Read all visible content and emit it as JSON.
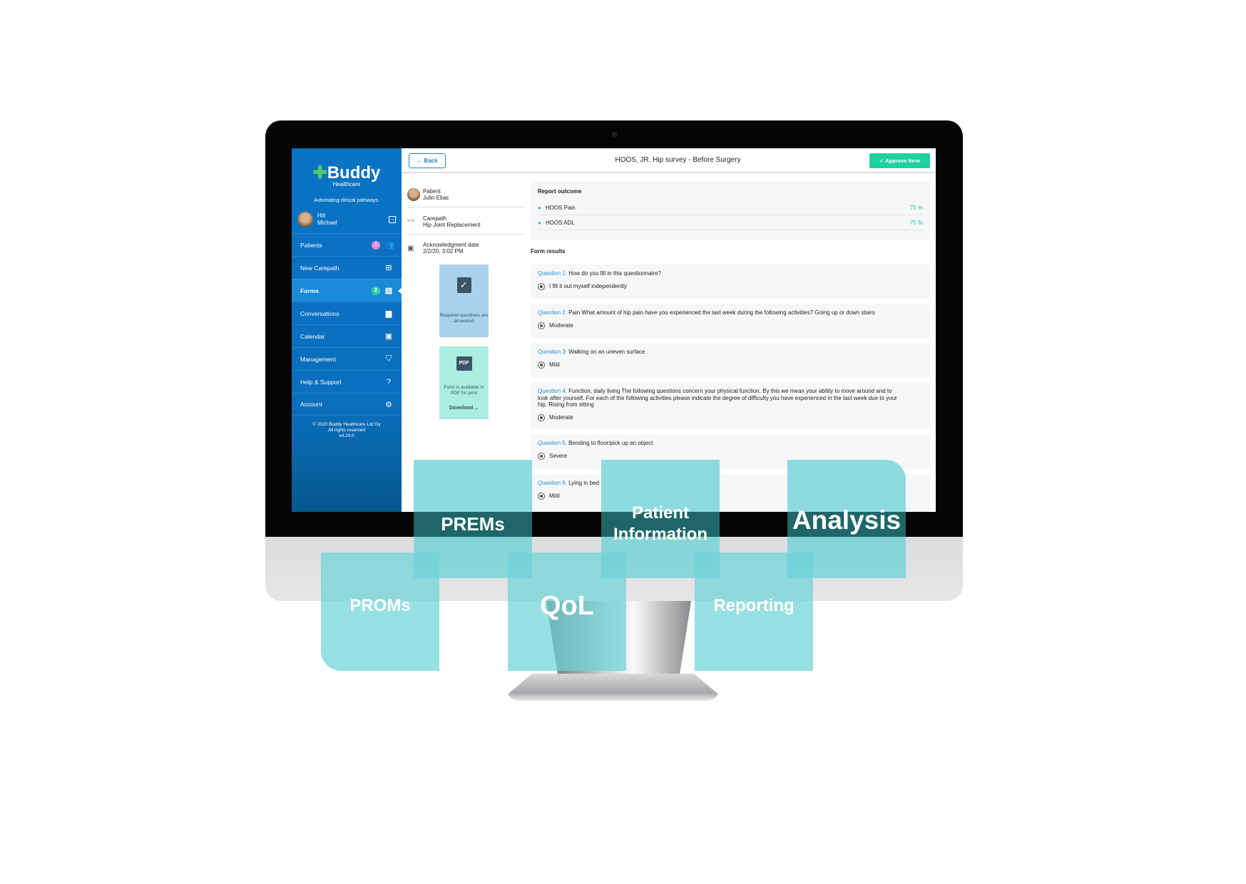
{
  "app": {
    "logo": "Buddy",
    "logo_sub": "Healthcare",
    "tagline": "Automating clinical pathways."
  },
  "user": {
    "last_name": "Hill",
    "first_name": "Michael"
  },
  "sidebar": {
    "items": [
      {
        "label": "Patients",
        "badge": "1",
        "badge_color": "#e08be0",
        "icon": "people-icon"
      },
      {
        "label": "New Carepath",
        "icon": "plus-box-icon"
      },
      {
        "label": "Forms",
        "badge": "2",
        "badge_color": "#2bd0a0",
        "icon": "clipboard-icon",
        "active": true
      },
      {
        "label": "Conversations",
        "icon": "chat-icon"
      },
      {
        "label": "Calendar",
        "icon": "calendar-icon"
      },
      {
        "label": "Management",
        "icon": "shield-check-icon"
      },
      {
        "label": "Help & Support",
        "icon": "help-icon"
      },
      {
        "label": "Account",
        "icon": "gear-icon"
      }
    ],
    "copyright": [
      "© 2020 Buddy Healthcare Ltd Oy",
      "All rights reserved",
      "v4.24.0"
    ]
  },
  "header": {
    "back": "Back",
    "title": "HOOS, JR. Hip survey - Before Surgery",
    "approve": "Approve form"
  },
  "details": {
    "patient_label": "Patient",
    "patient": "Julin Elias",
    "carepath_label": "Carepath",
    "carepath": "Hip Joint Replacement",
    "ack_label": "Acknowledgment date",
    "ack": "2/2/20, 3:02 PM",
    "required_card": "Required questions are answered",
    "pdf_card": "Form is available in PDF for print",
    "download": "Download ..."
  },
  "report": {
    "title": "Report outcome",
    "rows": [
      {
        "label": "HOOS Pain",
        "value": "75 %"
      },
      {
        "label": "HOOS ADL",
        "value": "75 %"
      }
    ]
  },
  "form_results": {
    "title": "Form results",
    "questions": [
      {
        "num": "Question 1:",
        "text": "How do you fill in this questionnaire?",
        "answer": "I fill it out myself independently"
      },
      {
        "num": "Question 2:",
        "text": "Pain What amount of hip pain have you experienced the last week during the following activities?   Going up or down stairs",
        "answer": "Moderate"
      },
      {
        "num": "Question 3:",
        "text": "Walking on an uneven surface",
        "answer": "Mild"
      },
      {
        "num": "Question 4:",
        "text": "Function, daily living The following questions concern your physical function. By this we mean your ability to move around and to look after yourself. For each of the following activities please indicate the degree of difficulty you have experienced in the last week due to your hip.  Rising from sitting",
        "answer": "Moderate"
      },
      {
        "num": "Question 5:",
        "text": "Bending to floor/pick up an object",
        "answer": "Severe"
      },
      {
        "num": "Question 6:",
        "text": "Lying in bed",
        "answer": "Mild"
      }
    ]
  },
  "tiles": {
    "prems": "PREMs",
    "patient_info": "Patient Information",
    "analysis": "Analysis",
    "proms": "PROMs",
    "qol": "QoL",
    "reporting": "Reporting"
  }
}
